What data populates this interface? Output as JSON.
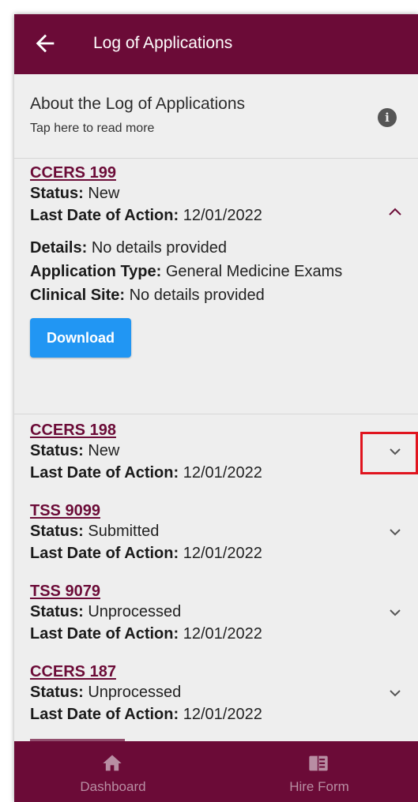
{
  "header": {
    "title": "Log of Applications",
    "back_icon": "arrow-left-icon"
  },
  "about": {
    "heading": "About the Log of Applications",
    "subtext": "Tap here to read more",
    "info_icon": "info-icon",
    "info_glyph": "i"
  },
  "applications": [
    {
      "code": "CCERS 199",
      "status_label": "Status:",
      "status": "New",
      "last_action_label": "Last Date of Action:",
      "last_action": "12/01/2022",
      "expanded": true,
      "details_label": "Details:",
      "details": "No details provided",
      "type_label": "Application Type:",
      "type": "General Medicine Exams",
      "site_label": "Clinical Site:",
      "site": "No details provided",
      "download_label": "Download"
    },
    {
      "code": "CCERS 198",
      "status_label": "Status:",
      "status": "New",
      "last_action_label": "Last Date of Action:",
      "last_action": "12/01/2022",
      "expanded": false
    },
    {
      "code": "TSS 9099",
      "status_label": "Status:",
      "status": "Submitted",
      "last_action_label": "Last Date of Action:",
      "last_action": "12/01/2022",
      "expanded": false
    },
    {
      "code": "TSS 9079",
      "status_label": "Status:",
      "status": "Unprocessed",
      "last_action_label": "Last Date of Action:",
      "last_action": "12/01/2022",
      "expanded": false
    },
    {
      "code": "CCERS 187",
      "status_label": "Status:",
      "status": "Unprocessed",
      "last_action_label": "Last Date of Action:",
      "last_action": "12/01/2022",
      "expanded": false
    }
  ],
  "bottom_nav": {
    "items": [
      {
        "label": "Dashboard",
        "icon": "home-icon"
      },
      {
        "label": "Hire Form",
        "icon": "form-icon"
      }
    ]
  },
  "colors": {
    "brand": "#6b0b37",
    "accent_button": "#2196f3",
    "highlight": "#e0141e"
  }
}
